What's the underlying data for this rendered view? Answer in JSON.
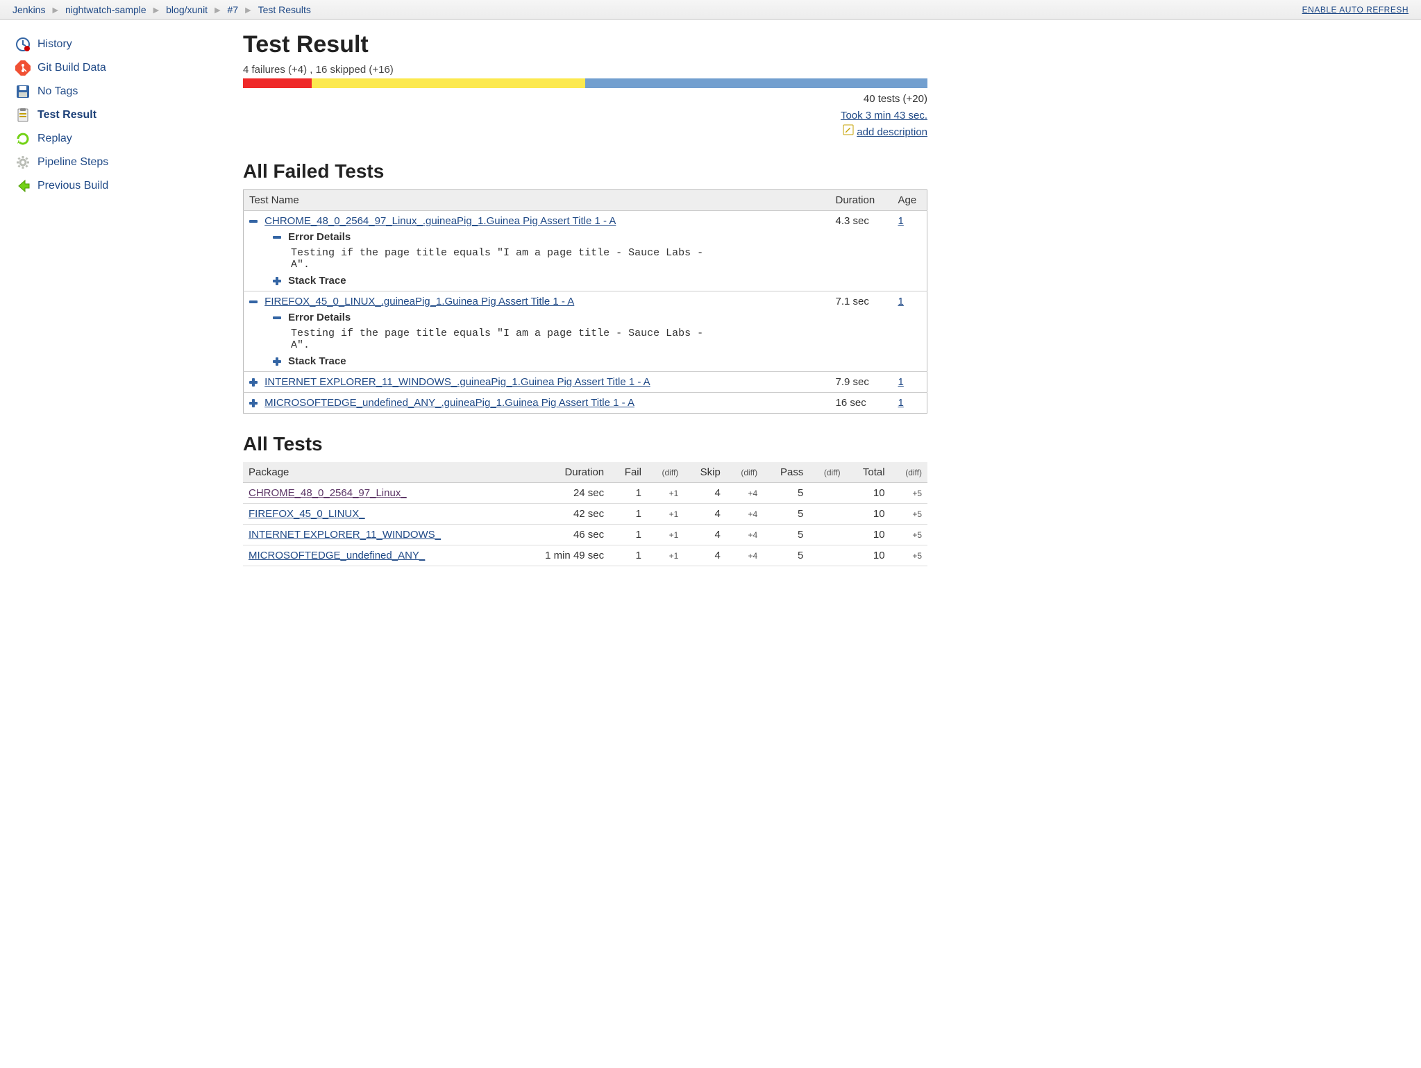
{
  "breadcrumb": {
    "items": [
      "Jenkins",
      "nightwatch-sample",
      "blog/xunit",
      "#7",
      "Test Results"
    ],
    "auto_refresh": "ENABLE AUTO REFRESH"
  },
  "sidebar": {
    "items": [
      {
        "label": "History",
        "icon": "history-icon"
      },
      {
        "label": "Git Build Data",
        "icon": "git-icon"
      },
      {
        "label": "No Tags",
        "icon": "save-icon"
      },
      {
        "label": "Test Result",
        "icon": "clipboard-icon",
        "active": true
      },
      {
        "label": "Replay",
        "icon": "replay-icon"
      },
      {
        "label": "Pipeline Steps",
        "icon": "gear-icon"
      },
      {
        "label": "Previous Build",
        "icon": "arrow-left-icon"
      }
    ]
  },
  "page_title": "Test Result",
  "summary": {
    "line": "4 failures (+4) , 16 skipped (+16)",
    "bar": {
      "fail_pct": 10,
      "skip_pct": 40,
      "pass_pct": 50
    },
    "tests_total": "40 tests (+20)",
    "duration_link": "Took 3 min 43 sec.",
    "add_description": "add description"
  },
  "failed_section": {
    "heading": "All Failed Tests",
    "columns": {
      "name": "Test Name",
      "duration": "Duration",
      "age": "Age"
    },
    "error_details_label": "Error Details",
    "stack_trace_label": "Stack Trace",
    "rows": [
      {
        "expanded": true,
        "name": "CHROME_48_0_2564_97_Linux_.guineaPig_1.Guinea Pig Assert Title 1 - A",
        "error": "Testing if the page title equals \"I am a page title - Sauce Labs - A\".",
        "duration": "4.3 sec",
        "age": "1"
      },
      {
        "expanded": true,
        "name": "FIREFOX_45_0_LINUX_.guineaPig_1.Guinea Pig Assert Title 1 - A",
        "error": "Testing if the page title equals \"I am a page title - Sauce Labs - A\".",
        "duration": "7.1 sec",
        "age": "1"
      },
      {
        "expanded": false,
        "name": "INTERNET EXPLORER_11_WINDOWS_.guineaPig_1.Guinea Pig Assert Title 1 - A",
        "duration": "7.9 sec",
        "age": "1"
      },
      {
        "expanded": false,
        "name": "MICROSOFTEDGE_undefined_ANY_.guineaPig_1.Guinea Pig Assert Title 1 - A",
        "duration": "16 sec",
        "age": "1"
      }
    ]
  },
  "all_tests_section": {
    "heading": "All Tests",
    "columns": {
      "package": "Package",
      "duration": "Duration",
      "fail": "Fail",
      "fail_diff": "(diff)",
      "skip": "Skip",
      "skip_diff": "(diff)",
      "pass": "Pass",
      "pass_diff": "(diff)",
      "total": "Total",
      "total_diff": "(diff)"
    },
    "rows": [
      {
        "package": "CHROME_48_0_2564_97_Linux_",
        "visited": true,
        "duration": "24 sec",
        "fail": "1",
        "fail_diff": "+1",
        "skip": "4",
        "skip_diff": "+4",
        "pass": "5",
        "pass_diff": "",
        "total": "10",
        "total_diff": "+5"
      },
      {
        "package": "FIREFOX_45_0_LINUX_",
        "duration": "42 sec",
        "fail": "1",
        "fail_diff": "+1",
        "skip": "4",
        "skip_diff": "+4",
        "pass": "5",
        "pass_diff": "",
        "total": "10",
        "total_diff": "+5"
      },
      {
        "package": "INTERNET EXPLORER_11_WINDOWS_",
        "duration": "46 sec",
        "fail": "1",
        "fail_diff": "+1",
        "skip": "4",
        "skip_diff": "+4",
        "pass": "5",
        "pass_diff": "",
        "total": "10",
        "total_diff": "+5"
      },
      {
        "package": "MICROSOFTEDGE_undefined_ANY_",
        "duration": "1 min 49 sec",
        "fail": "1",
        "fail_diff": "+1",
        "skip": "4",
        "skip_diff": "+4",
        "pass": "5",
        "pass_diff": "",
        "total": "10",
        "total_diff": "+5"
      }
    ]
  }
}
